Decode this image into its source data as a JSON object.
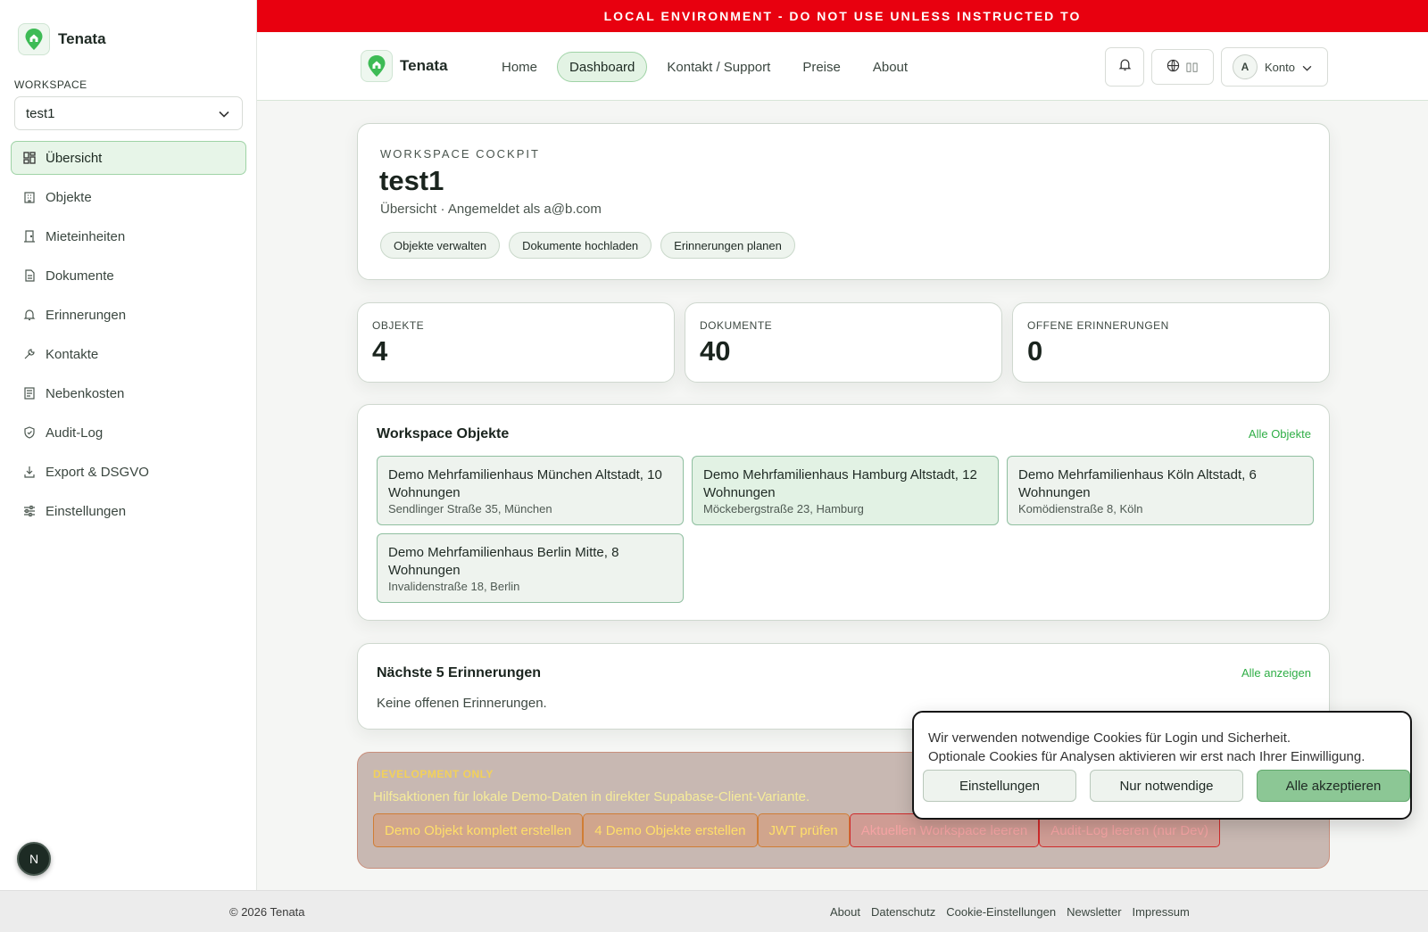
{
  "banner": "LOCAL ENVIRONMENT - DO NOT USE UNLESS INSTRUCTED TO",
  "brand": "Tenata",
  "sidebar": {
    "workspace_label": "WORKSPACE",
    "workspace_value": "test1",
    "items": [
      {
        "label": "Übersicht",
        "icon": "grid-icon",
        "active": true
      },
      {
        "label": "Objekte",
        "icon": "building-icon"
      },
      {
        "label": "Mieteinheiten",
        "icon": "door-icon"
      },
      {
        "label": "Dokumente",
        "icon": "document-icon"
      },
      {
        "label": "Erinnerungen",
        "icon": "bell-icon"
      },
      {
        "label": "Kontakte",
        "icon": "wrench-icon"
      },
      {
        "label": "Nebenkosten",
        "icon": "receipt-icon"
      },
      {
        "label": "Audit-Log",
        "icon": "shield-icon"
      },
      {
        "label": "Export & DSGVO",
        "icon": "download-icon"
      },
      {
        "label": "Einstellungen",
        "icon": "sliders-icon"
      }
    ]
  },
  "topbar": {
    "nav": [
      "Home",
      "Dashboard",
      "Kontakt / Support",
      "Preise",
      "About"
    ],
    "lang": "▯▯",
    "avatar_initial": "A",
    "account": "Konto"
  },
  "cockpit": {
    "eyebrow": "WORKSPACE COCKPIT",
    "title": "test1",
    "subtitle": "Übersicht · Angemeldet als a@b.com",
    "chips": [
      "Objekte verwalten",
      "Dokumente hochladen",
      "Erinnerungen planen"
    ]
  },
  "stats": [
    {
      "label": "OBJEKTE",
      "value": "4"
    },
    {
      "label": "DOKUMENTE",
      "value": "40"
    },
    {
      "label": "OFFENE ERINNERUNGEN",
      "value": "0"
    }
  ],
  "objects": {
    "title": "Workspace Objekte",
    "link": "Alle Objekte",
    "items": [
      {
        "name": "Demo Mehrfamilienhaus München Altstadt, 10 Wohnungen",
        "address": "Sendlinger Straße 35, München"
      },
      {
        "name": "Demo Mehrfamilienhaus Hamburg Altstadt, 12 Wohnungen",
        "address": "Möckebergstraße 23, Hamburg"
      },
      {
        "name": "Demo Mehrfamilienhaus Köln Altstadt, 6 Wohnungen",
        "address": "Komödienstraße 8, Köln"
      },
      {
        "name": "Demo Mehrfamilienhaus Berlin Mitte, 8 Wohnungen",
        "address": "Invalidenstraße 18, Berlin"
      }
    ]
  },
  "reminders": {
    "title": "Nächste 5 Erinnerungen",
    "link": "Alle anzeigen",
    "empty": "Keine offenen Erinnerungen."
  },
  "dev": {
    "label": "DEVELOPMENT ONLY",
    "text": "Hilfsaktionen für lokale Demo-Daten in direkter Supabase-Client-Variante.",
    "buttons": [
      "Demo Objekt komplett erstellen",
      "4 Demo Objekte erstellen",
      "JWT prüfen",
      "Aktuellen Workspace leeren",
      "Audit-Log leeren (nur Dev)"
    ]
  },
  "cookie": {
    "line1": "Wir verwenden notwendige Cookies für Login und Sicherheit.",
    "line2": "Optionale Cookies für Analysen aktivieren wir erst nach Ihrer Einwilligung.",
    "buttons": [
      "Einstellungen",
      "Nur notwendige",
      "Alle akzeptieren"
    ]
  },
  "footer": {
    "copyright": "© 2026 Tenata",
    "links": [
      "About",
      "Datenschutz",
      "Cookie-Einstellungen",
      "Newsletter",
      "Impressum"
    ]
  },
  "dev_badge": "N",
  "colors": {
    "accent": "#2fae46",
    "banner": "#e8000f",
    "active_bg": "#e7f5e8"
  }
}
